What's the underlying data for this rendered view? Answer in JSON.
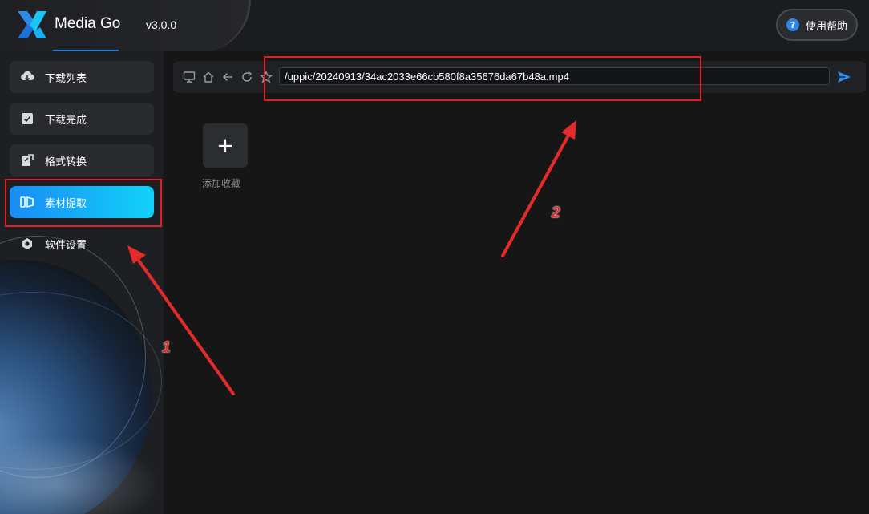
{
  "header": {
    "app_name": "Media Go",
    "version": "v3.0.0",
    "help_label": "使用帮助",
    "help_icon": "?"
  },
  "sidebar": {
    "items": [
      {
        "label": "下载列表",
        "icon": "cloud-download-icon",
        "active": false
      },
      {
        "label": "下载完成",
        "icon": "check-box-icon",
        "active": false
      },
      {
        "label": "格式转换",
        "icon": "convert-icon",
        "active": false
      },
      {
        "label": "素材提取",
        "icon": "extract-icon",
        "active": true
      },
      {
        "label": "软件设置",
        "icon": "hexagon-settings-icon",
        "active": false
      }
    ]
  },
  "toolbar": {
    "url_value": "/uppic/20240913/34ac2033e66cb580f8a35676da67b48a.mp4",
    "icons": [
      "desktop-icon",
      "home-icon",
      "back-arrow-icon",
      "refresh-icon",
      "star-icon",
      "send-icon"
    ]
  },
  "favorites": {
    "add_symbol": "+",
    "add_label": "添加收藏"
  },
  "annotations": {
    "label_1": "1",
    "label_2": "2"
  },
  "colors": {
    "accent_start": "#1a8cf5",
    "accent_end": "#12d2f8",
    "annotation_red": "#e02027",
    "background": "#161616"
  }
}
